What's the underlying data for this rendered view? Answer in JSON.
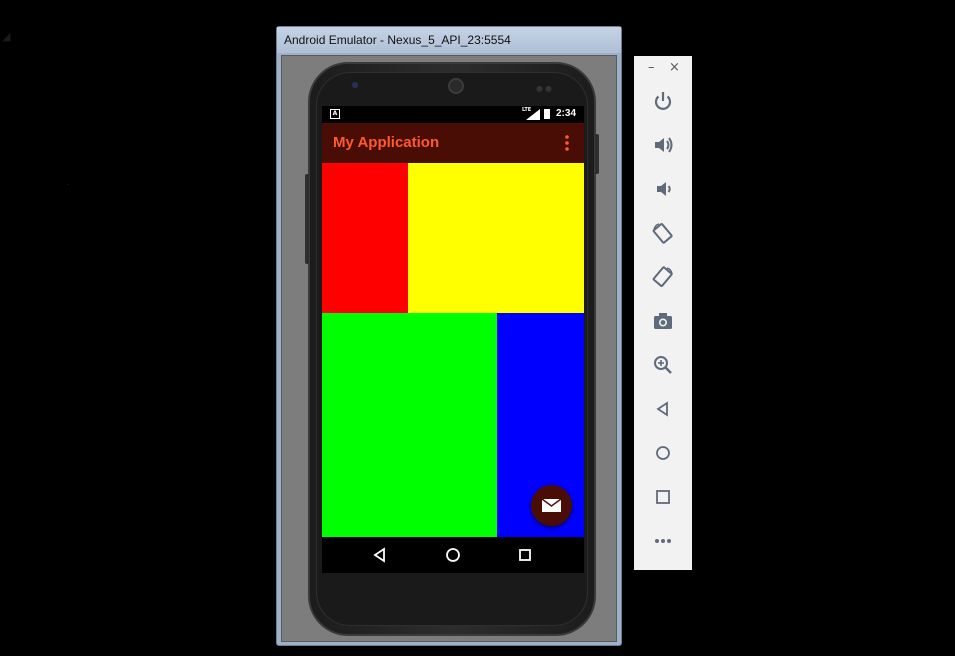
{
  "window": {
    "title": "Android Emulator - Nexus_5_API_23:5554"
  },
  "status_bar": {
    "notification_glyph": "A",
    "network_label": "LTE",
    "time": "2:34"
  },
  "app_bar": {
    "title": "My Application",
    "title_color": "#ff5a2b",
    "background": "#4a0d05"
  },
  "content": {
    "blocks": [
      {
        "name": "red-block",
        "color": "#ff0000"
      },
      {
        "name": "yellow-block",
        "color": "#ffff00"
      },
      {
        "name": "green-block",
        "color": "#00ff00"
      },
      {
        "name": "blue-block",
        "color": "#0000ff"
      }
    ]
  },
  "fab": {
    "icon": "email-icon",
    "color": "#4a0d05"
  },
  "navigation": {
    "buttons": [
      "back-icon",
      "home-icon",
      "recents-icon"
    ]
  },
  "side_toolbar": {
    "minimize_label": "–",
    "close_label": "×",
    "tools": [
      "power-icon",
      "volume-up-icon",
      "volume-down-icon",
      "rotate-left-icon",
      "rotate-right-icon",
      "camera-icon",
      "zoom-icon",
      "back-icon",
      "home-icon",
      "overview-icon",
      "more-icon"
    ],
    "icon_color": "#5f6b7a"
  }
}
